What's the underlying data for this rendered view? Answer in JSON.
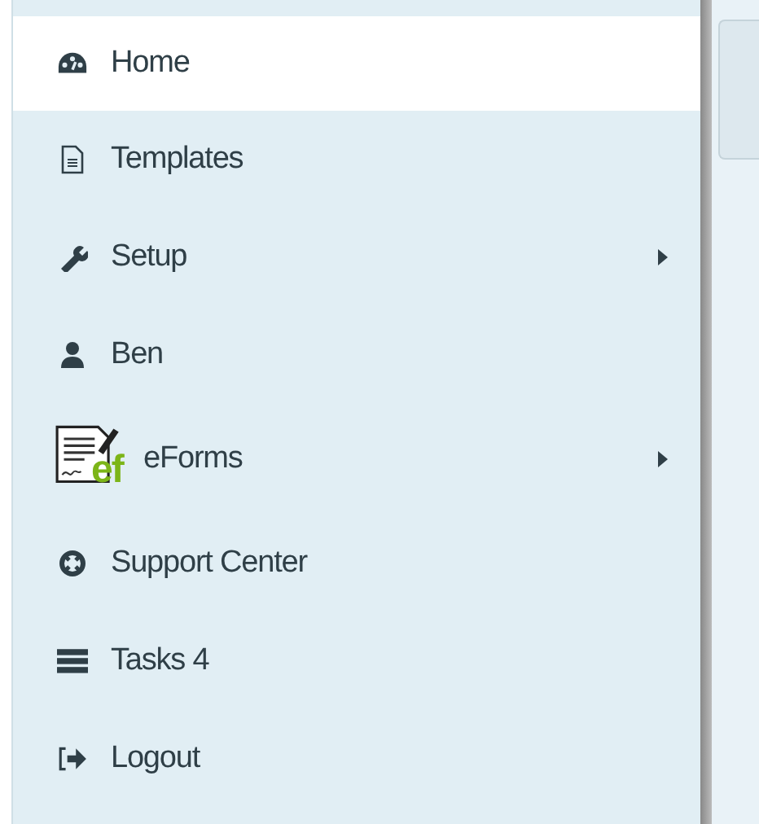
{
  "menu": {
    "items": [
      {
        "label": "Home",
        "selected": true,
        "has_submenu": false
      },
      {
        "label": "Templates",
        "selected": false,
        "has_submenu": false
      },
      {
        "label": "Setup",
        "selected": false,
        "has_submenu": true
      },
      {
        "label": "Ben",
        "selected": false,
        "has_submenu": false
      },
      {
        "label": "eForms",
        "selected": false,
        "has_submenu": true,
        "logo_text": "ef"
      },
      {
        "label": "Support Center",
        "selected": false,
        "has_submenu": false
      },
      {
        "label": "Tasks 4",
        "selected": false,
        "has_submenu": false
      },
      {
        "label": "Logout",
        "selected": false,
        "has_submenu": false
      }
    ]
  }
}
